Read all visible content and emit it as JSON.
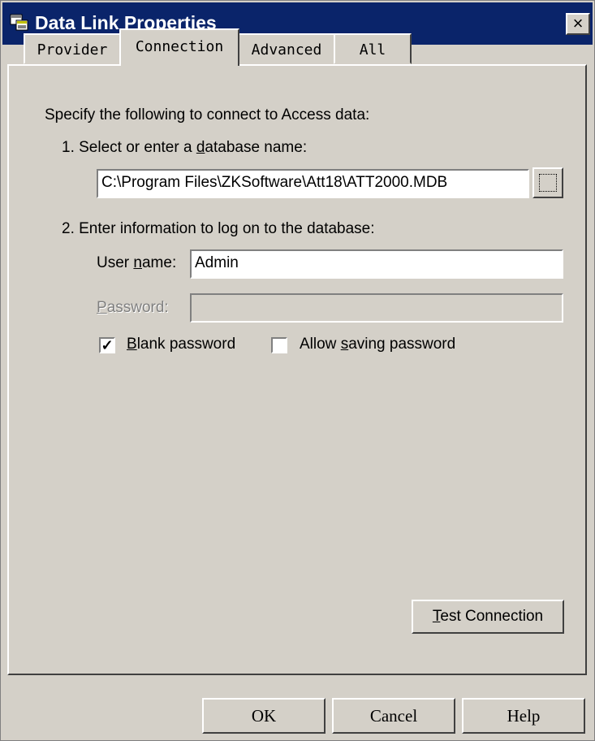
{
  "window": {
    "title": "Data Link Properties",
    "close_label": "×"
  },
  "tabs": [
    "Provider",
    "Connection",
    "Advanced",
    "All"
  ],
  "active_tab": "Connection",
  "connection": {
    "intro": "Specify the following to connect to Access data:",
    "step1_label": "1. Select or enter a database name:",
    "database_path": "C:\\Program Files\\ZKSoftware\\Att18\\ATT2000.MDB",
    "step2_label": "2. Enter information to log on to the database:",
    "username_label": "User name:",
    "username_value": "Admin",
    "password_label": "Password:",
    "password_value": "",
    "blank_password_label": "Blank password",
    "blank_password_checked": true,
    "allow_saving_label": "Allow saving password",
    "allow_saving_checked": false,
    "test_connection_label": "Test Connection"
  },
  "footer": {
    "ok": "OK",
    "cancel": "Cancel",
    "help": "Help"
  }
}
